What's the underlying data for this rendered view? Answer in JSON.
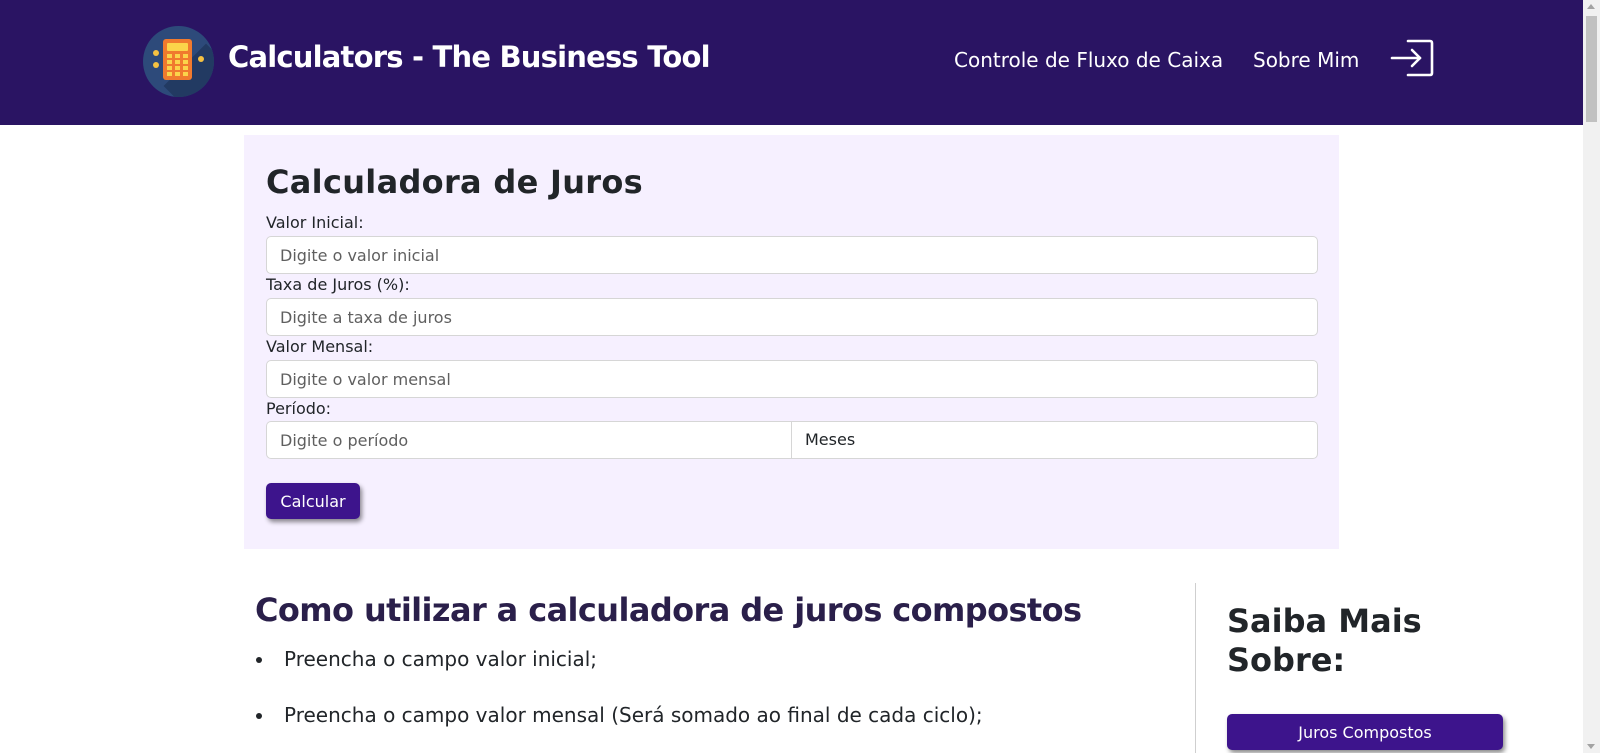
{
  "header": {
    "brand": "Calculators - The Business Tool",
    "logo_icon": "calculator-icon",
    "nav": [
      "Controle de Fluxo de Caixa",
      "Sobre Mim"
    ],
    "login_icon": "login-icon",
    "background": "#2a1463"
  },
  "calculator": {
    "title": "Calculadora de Juros",
    "fields": {
      "initial": {
        "label": "Valor Inicial:",
        "placeholder": "Digite o valor inicial"
      },
      "rate": {
        "label": "Taxa de Juros (%):",
        "placeholder": "Digite a taxa de juros"
      },
      "monthly": {
        "label": "Valor Mensal:",
        "placeholder": "Digite o valor mensal"
      },
      "period": {
        "label": "Período:",
        "placeholder": "Digite o período",
        "unit": "Meses"
      }
    },
    "button": "Calcular",
    "panel_color": "#f6f0ff",
    "accent": "#3d148c"
  },
  "howto": {
    "title": "Como utilizar a calculadora de juros compostos",
    "items": [
      "Preencha o campo valor inicial;",
      "Preencha o campo valor mensal (Será somado ao final de cada ciclo);"
    ]
  },
  "aside": {
    "title": "Saiba Mais Sobre:",
    "button": "Juros Compostos"
  }
}
